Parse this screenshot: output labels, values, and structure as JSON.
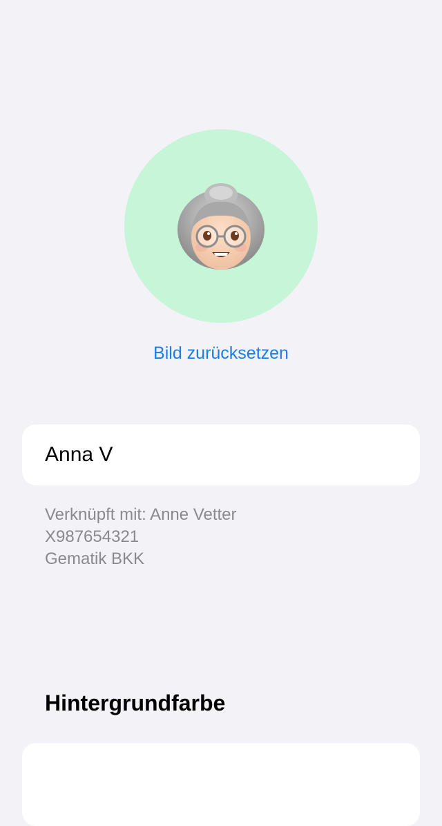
{
  "avatar": {
    "icon": "grandma-emoji-icon",
    "background_color": "#c6f5d7"
  },
  "reset_link_label": "Bild zurücksetzen",
  "profile": {
    "name_value": "Anna V"
  },
  "linked": {
    "line1": "Verknüpft mit: Anne Vetter",
    "line2": "X987654321",
    "line3": "Gematik BKK"
  },
  "background_section": {
    "title": "Hintergrundfarbe"
  },
  "colors": {
    "accent": "#1a7ee6",
    "page_background": "#f2f2f7",
    "secondary_text": "#8a8a8e"
  }
}
